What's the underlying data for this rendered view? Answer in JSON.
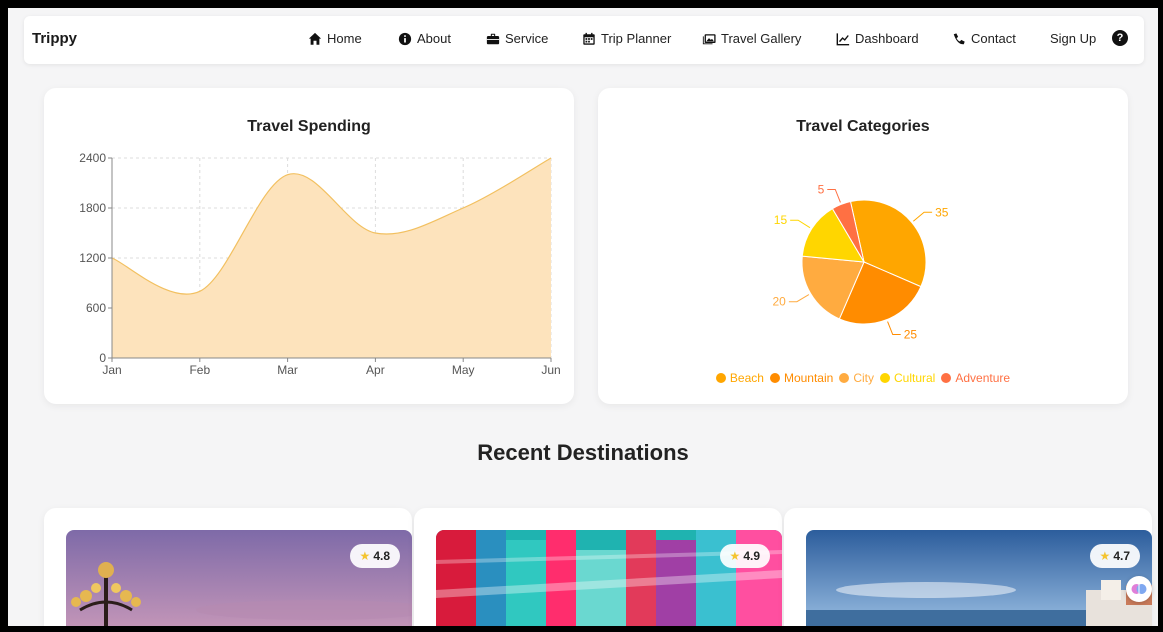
{
  "brand": "Trippy",
  "nav": {
    "home": "Home",
    "about": "About",
    "service": "Service",
    "trip_planner": "Trip Planner",
    "travel_gallery": "Travel Gallery",
    "dashboard": "Dashboard",
    "contact": "Contact",
    "sign_up": "Sign Up",
    "help": "?"
  },
  "spending": {
    "title": "Travel Spending"
  },
  "categories": {
    "title": "Travel Categories"
  },
  "section_title": "Recent Destinations",
  "destinations": [
    {
      "rating": "4.8"
    },
    {
      "rating": "4.9"
    },
    {
      "rating": "4.7"
    }
  ],
  "colors": {
    "area_fill": "#fde3bc",
    "area_stroke": "#f2c060",
    "beach": "#ffa600",
    "mountain": "#ff8c00",
    "city": "#ffab40",
    "cultural": "#ffd600",
    "adventure": "#ff7043"
  },
  "chart_data": [
    {
      "type": "area",
      "title": "Travel Spending",
      "categories": [
        "Jan",
        "Feb",
        "Mar",
        "Apr",
        "May",
        "Jun"
      ],
      "values": [
        1200,
        800,
        2200,
        1500,
        1800,
        2400
      ],
      "yticks": [
        0,
        600,
        1200,
        1800,
        2400
      ],
      "ylim": [
        0,
        2400
      ],
      "grid": true
    },
    {
      "type": "pie",
      "title": "Travel Categories",
      "labels": [
        "Beach",
        "Mountain",
        "City",
        "Cultural",
        "Adventure"
      ],
      "values": [
        35,
        25,
        20,
        15,
        5
      ],
      "legend": "bottom"
    }
  ]
}
